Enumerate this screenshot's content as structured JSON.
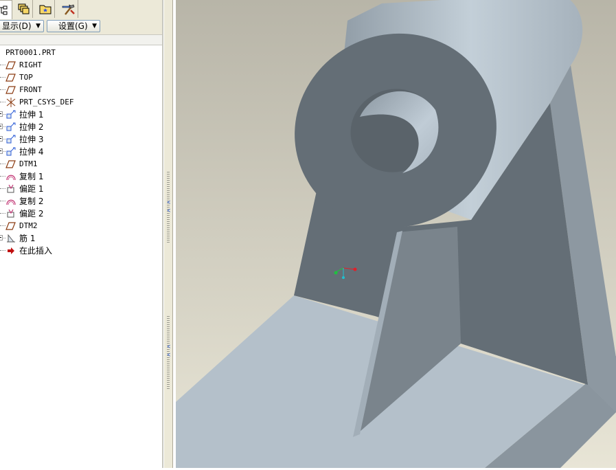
{
  "left_panel": {
    "tabs": [
      {
        "name": "model-tree",
        "icon": "model-tree-icon",
        "active": true
      },
      {
        "name": "layers",
        "icon": "layers-icon",
        "active": false
      },
      {
        "name": "favorites",
        "icon": "folder-icon",
        "active": false
      },
      {
        "name": "tools",
        "icon": "tools-icon",
        "active": false
      }
    ],
    "menu": {
      "show_label": "显示(D)",
      "settings_label": "设置(G)"
    },
    "tree": {
      "root": "PRT0001.PRT",
      "items": [
        {
          "label": "RIGHT",
          "icon": "datum-plane-icon",
          "expandable": false
        },
        {
          "label": "TOP",
          "icon": "datum-plane-icon",
          "expandable": false
        },
        {
          "label": "FRONT",
          "icon": "datum-plane-icon",
          "expandable": false
        },
        {
          "label": "PRT_CSYS_DEF",
          "icon": "coordinate-system-icon",
          "expandable": false
        },
        {
          "label": "拉伸 1",
          "icon": "extrude-icon",
          "expandable": true
        },
        {
          "label": "拉伸 2",
          "icon": "extrude-icon",
          "expandable": true
        },
        {
          "label": "拉伸 3",
          "icon": "extrude-icon",
          "expandable": true
        },
        {
          "label": "拉伸 4",
          "icon": "extrude-icon",
          "expandable": true
        },
        {
          "label": "DTM1",
          "icon": "datum-plane-icon",
          "expandable": false
        },
        {
          "label": "复制 1",
          "icon": "copy-surface-icon",
          "expandable": false
        },
        {
          "label": "偏距 1",
          "icon": "offset-icon",
          "expandable": false
        },
        {
          "label": "复制 2",
          "icon": "copy-surface-icon",
          "expandable": false
        },
        {
          "label": "偏距 2",
          "icon": "offset-icon",
          "expandable": false
        },
        {
          "label": "DTM2",
          "icon": "datum-plane-icon",
          "expandable": false
        },
        {
          "label": "筋 1",
          "icon": "rib-icon",
          "expandable": true
        },
        {
          "label": "在此插入",
          "icon": "insert-here-arrow-icon",
          "expandable": false
        }
      ]
    }
  },
  "viewport": {
    "background_top": "#b9b6a9",
    "background_bottom": "#e6e2d2",
    "model_color_light": "#b7c3cd",
    "model_color_dark": "#6a747c",
    "csys_axes": {
      "x": "#e0202a",
      "y": "#20c040",
      "z": "#20c0d0"
    }
  }
}
